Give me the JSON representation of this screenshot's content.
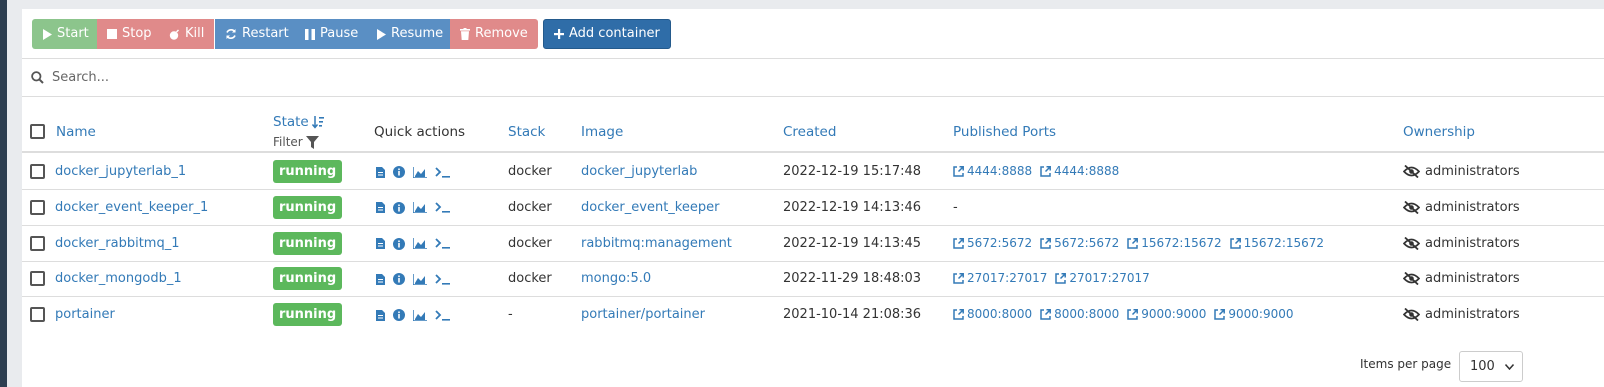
{
  "toolbar": {
    "start": "Start",
    "stop": "Stop",
    "kill": "Kill",
    "restart": "Restart",
    "pause": "Pause",
    "resume": "Resume",
    "remove": "Remove",
    "add": "Add container"
  },
  "search": {
    "placeholder": "Search..."
  },
  "columns": {
    "name": "Name",
    "state": "State",
    "filter": "Filter",
    "quick_actions": "Quick actions",
    "stack": "Stack",
    "image": "Image",
    "created": "Created",
    "ports": "Published Ports",
    "ownership": "Ownership"
  },
  "rows": [
    {
      "name": "docker_jupyterlab_1",
      "state": "running",
      "stack": "docker",
      "image": "docker_jupyterlab",
      "created": "2022-12-19 15:17:48",
      "ports": [
        "4444:8888",
        "4444:8888"
      ],
      "ownership": "administrators"
    },
    {
      "name": "docker_event_keeper_1",
      "state": "running",
      "stack": "docker",
      "image": "docker_event_keeper",
      "created": "2022-12-19 14:13:46",
      "ports_text": "-",
      "ports": [],
      "ownership": "administrators"
    },
    {
      "name": "docker_rabbitmq_1",
      "state": "running",
      "stack": "docker",
      "image": "rabbitmq:management",
      "created": "2022-12-19 14:13:45",
      "ports": [
        "5672:5672",
        "5672:5672",
        "15672:15672",
        "15672:15672"
      ],
      "ownership": "administrators"
    },
    {
      "name": "docker_mongodb_1",
      "state": "running",
      "stack": "docker",
      "image": "mongo:5.0",
      "created": "2022-11-29 18:48:03",
      "ports": [
        "27017:27017",
        "27017:27017"
      ],
      "ownership": "administrators"
    },
    {
      "name": "portainer",
      "state": "running",
      "stack": "-",
      "image": "portainer/portainer",
      "created": "2021-10-14 21:08:36",
      "ports": [
        "8000:8000",
        "8000:8000",
        "9000:9000",
        "9000:9000"
      ],
      "ownership": "administrators"
    }
  ],
  "footer": {
    "items_per_page_label": "Items per page",
    "items_per_page": "100"
  },
  "colors": {
    "accent": "#337ab7",
    "running": "#5cb85c",
    "start": "#8cc58c",
    "danger": "#e08a8a",
    "primary": "#5a8fc4"
  }
}
